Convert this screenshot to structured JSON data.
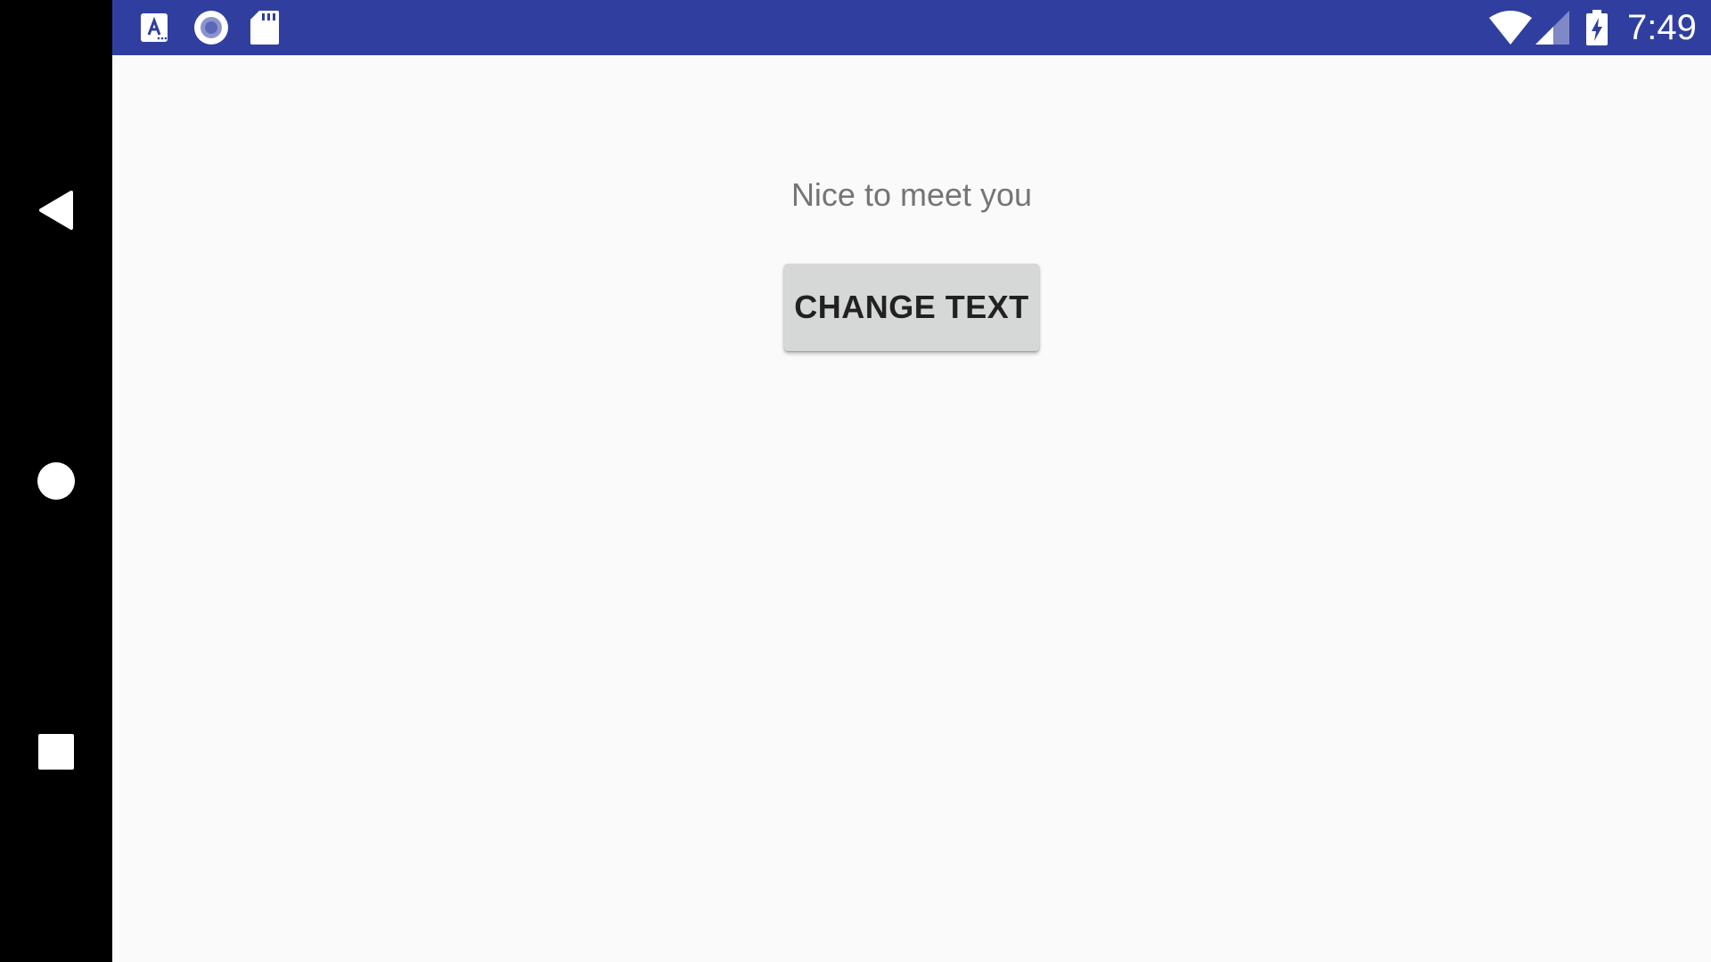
{
  "status_bar": {
    "time": "7:49",
    "background_color": "#303f9f",
    "left_icons": [
      "accessibility-a-icon",
      "radio-button-icon",
      "sd-card-icon"
    ],
    "right_icons": [
      "wifi-icon",
      "cell-signal-icon",
      "battery-charging-icon"
    ]
  },
  "navigation_bar": {
    "buttons": [
      "back-icon",
      "home-icon",
      "recents-icon"
    ]
  },
  "main": {
    "greeting_text": "Nice to meet you",
    "change_button_label": "CHANGE TEXT",
    "background_color": "#fafafa"
  }
}
